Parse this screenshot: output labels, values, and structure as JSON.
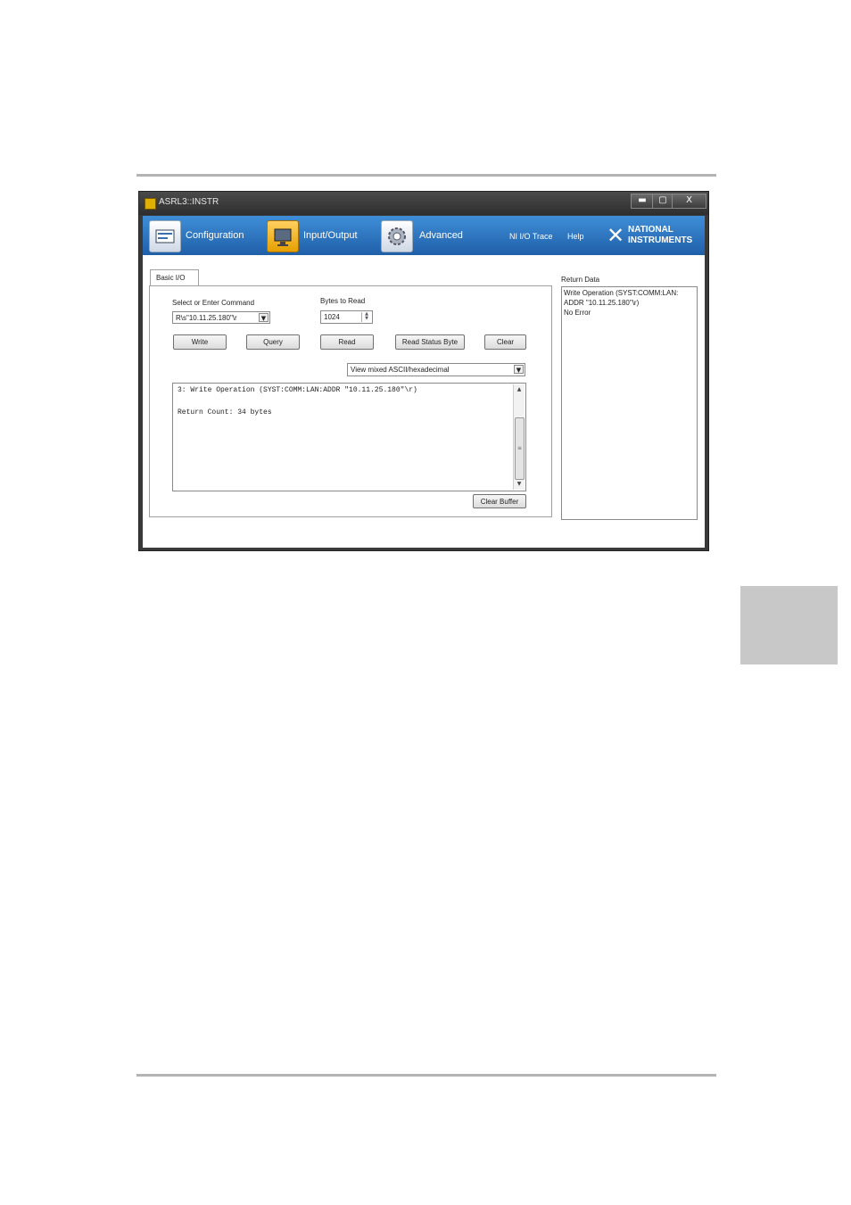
{
  "window": {
    "title": "ASRL3::INSTR",
    "minimize": "▬",
    "maximize": "▢",
    "close": "X"
  },
  "toolbar": {
    "configuration": "Configuration",
    "input_output": "Input/Output",
    "advanced": "Advanced",
    "ni_io_trace": "NI I/O Trace",
    "help": "Help",
    "logo_line1": "NATIONAL",
    "logo_line2": "INSTRUMENTS"
  },
  "tab": {
    "label": "Basic I/O"
  },
  "command": {
    "label": "Select or Enter Command",
    "value": "R\\s\"10.11.25.180\"\\r"
  },
  "bytes": {
    "label": "Bytes to Read",
    "value": "1024"
  },
  "buttons": {
    "write": "Write",
    "query": "Query",
    "read": "Read",
    "read_status": "Read Status Byte",
    "clear": "Clear"
  },
  "view_mode": "View mixed ASCII/hexadecimal",
  "buffer": {
    "line1": "3: Write Operation (SYST:COMM:LAN:ADDR \"10.11.25.180\"\\r)",
    "line2": "Return Count: 34 bytes"
  },
  "clear_buffer": "Clear Buffer",
  "return_data": {
    "label": "Return Data",
    "line1": "Write Operation (SYST:COMM:LAN:",
    "line2": "ADDR \"10.11.25.180\"\\r)",
    "line3": "No Error"
  },
  "colors": {
    "toolbar_top": "#3f8ed8",
    "toolbar_bottom": "#1f5fa8",
    "titlebar": "#3a3a3a"
  }
}
